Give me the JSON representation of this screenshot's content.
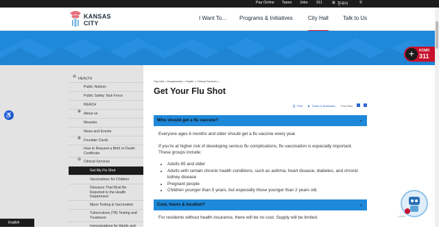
{
  "topbar": {
    "links": [
      "Pay Online",
      "Taxes",
      "Jobs",
      "311"
    ],
    "translate_label": "한국어"
  },
  "logo": {
    "line1": "KANSAS",
    "line2": "CITY"
  },
  "nav": {
    "items": [
      "I Want To...",
      "Programs & Initiatives",
      "City Hall",
      "Talk to Us"
    ],
    "active": "City Hall"
  },
  "kcmo": {
    "line1": "KCMO",
    "line2": "311",
    "plus": "+"
  },
  "sidebar": {
    "items": [
      {
        "label": "HEALTH",
        "icon": "⊖",
        "level": 0
      },
      {
        "label": "Public Notices",
        "level": 1
      },
      {
        "label": "Public Safety Task Force",
        "level": 1
      },
      {
        "label": "REACH",
        "level": 1
      },
      {
        "label": "About us",
        "icon": "⊕",
        "level": 1
      },
      {
        "label": "Measles",
        "level": 1
      },
      {
        "label": "News and Events",
        "level": 1
      },
      {
        "label": "Fountain Cards",
        "icon": "⊕",
        "level": 1
      },
      {
        "label": "How to Request a Birth or Death Certificate",
        "level": 1
      },
      {
        "label": "Clinical Services",
        "icon": "⊖",
        "level": 1
      },
      {
        "label": "Get My Flu Shot",
        "level": 2,
        "active": true
      },
      {
        "label": "Vaccinations for Children",
        "level": 2
      },
      {
        "label": "Diseases That Must Be Reported to the Health Department",
        "level": 2
      },
      {
        "label": "Mpox Testing & Vaccination",
        "level": 2
      },
      {
        "label": "Tuberculosis (TB) Testing and Treatment",
        "level": 2
      },
      {
        "label": "Immunizations for Adults and",
        "level": 2
      }
    ]
  },
  "breadcrumb": "City Hall > Departments > Health > Clinical Services >",
  "page_title": "Get Your Flu Shot",
  "tools": {
    "print": "Print",
    "share": "Share & Bookmark",
    "font_size": "Font Size:",
    "minus": "−",
    "plus": "+"
  },
  "accordion": [
    {
      "label": "Who should get a flu vaccine?",
      "chevron": "⌄"
    },
    {
      "label": "Cost, hours & location?",
      "chevron": "⌄"
    }
  ],
  "content": {
    "p1": "Everyone ages 6 months and older should get a flu vaccine every year.",
    "p2": "If you're at higher risk of developing serious flu complications, flu vaccination is especially important. These groups include:",
    "bullets": [
      "Adults 65 and older",
      "Adults with certain chronic health conditions, such as asthma, heart disease, diabetes, and chronic kidney disease",
      "Pregnant people",
      "Children younger than 5 years, but especially those younger than 2 years old."
    ],
    "p3": "For residents without health insurance, there will be no cost. Supply will be limited."
  },
  "footer": {
    "english": "English"
  },
  "chat": {
    "label": "...ware"
  },
  "colors": {
    "accent_blue": "#1e88d9",
    "brand_red": "#c8102e",
    "dark": "#1c1c1c"
  }
}
